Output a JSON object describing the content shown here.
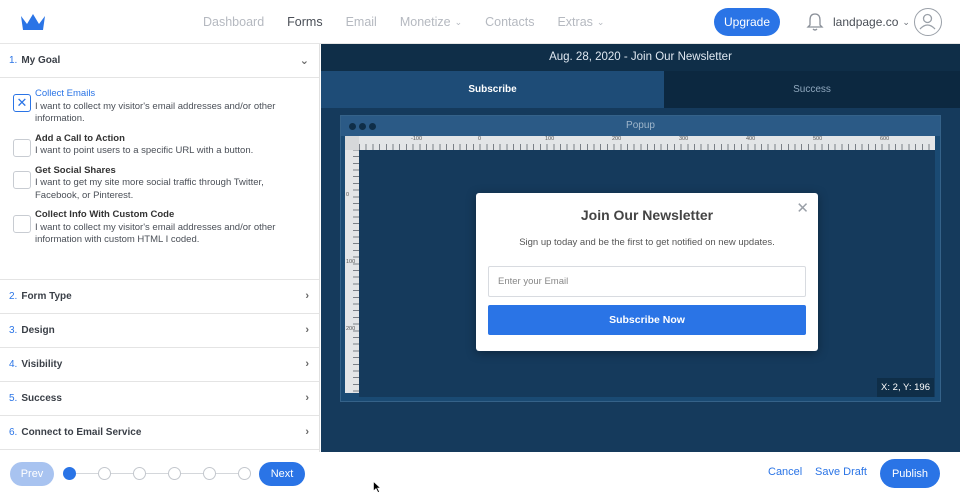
{
  "nav": {
    "items": [
      {
        "label": "Dashboard",
        "active": false,
        "dropdown": false
      },
      {
        "label": "Forms",
        "active": true,
        "dropdown": false
      },
      {
        "label": "Email",
        "active": false,
        "dropdown": false
      },
      {
        "label": "Monetize",
        "active": false,
        "dropdown": true
      },
      {
        "label": "Contacts",
        "active": false,
        "dropdown": false
      },
      {
        "label": "Extras",
        "active": false,
        "dropdown": true
      }
    ],
    "upgrade_label": "Upgrade",
    "account_label": "landpage.co",
    "icons": {
      "logo": "crown-logo",
      "bell": "bell-icon",
      "avatar": "user-avatar-icon"
    }
  },
  "steps": [
    {
      "num": "1.",
      "label": "My Goal",
      "expanded": true
    },
    {
      "num": "2.",
      "label": "Form Type",
      "expanded": false
    },
    {
      "num": "3.",
      "label": "Design",
      "expanded": false
    },
    {
      "num": "4.",
      "label": "Visibility",
      "expanded": false
    },
    {
      "num": "5.",
      "label": "Success",
      "expanded": false
    },
    {
      "num": "6.",
      "label": "Connect to Email Service",
      "expanded": false
    }
  ],
  "goals": [
    {
      "title": "Collect Emails",
      "desc": "I want to collect my visitor's email addresses and/or other information.",
      "checked": true
    },
    {
      "title": "Add a Call to Action",
      "desc": "I want to point users to a specific URL with a button.",
      "checked": false
    },
    {
      "title": "Get Social Shares",
      "desc": "I want to get my site more social traffic through Twitter, Facebook, or Pinterest.",
      "checked": false
    },
    {
      "title": "Collect Info With Custom Code",
      "desc": "I want to collect my visitor's email addresses and/or other information with custom HTML I coded.",
      "checked": false
    }
  ],
  "wizard": {
    "prev_label": "Prev",
    "next_label": "Next",
    "step_count": 6,
    "current_step": 1
  },
  "preview": {
    "title": "Aug. 28, 2020 - Join Our Newsletter",
    "tabs": [
      {
        "label": "Subscribe",
        "active": true
      },
      {
        "label": "Success",
        "active": false
      }
    ],
    "window_title": "Popup",
    "ruler_top_labels": [
      "-100",
      "0",
      "100",
      "200",
      "300",
      "400",
      "500",
      "600"
    ],
    "ruler_left_labels": [
      "0",
      "100",
      "200"
    ],
    "coords": "X: 2, Y: 196"
  },
  "popup": {
    "title": "Join Our Newsletter",
    "subtitle": "Sign up today and be the first to get notified on new updates.",
    "input_placeholder": "Enter your Email",
    "button_label": "Subscribe Now",
    "close_glyph": "✕"
  },
  "actions": {
    "cancel_label": "Cancel",
    "draft_label": "Save Draft",
    "publish_label": "Publish"
  },
  "colors": {
    "accent": "#2a74e6",
    "preview_bg": "#153a5c",
    "title_bar": "#0f2e48"
  }
}
